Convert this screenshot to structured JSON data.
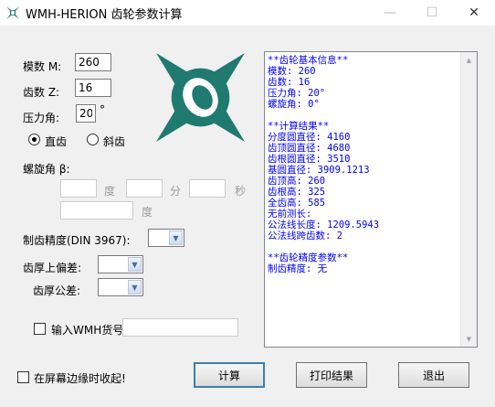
{
  "window": {
    "title": "WMH-HERION 齿轮参数计算"
  },
  "params": {
    "module_label": "模数 M:",
    "module_value": "260",
    "teeth_label": "齿数 Z:",
    "teeth_value": "16",
    "pressure_label": "压力角:",
    "pressure_value": "20",
    "pressure_unit": "°"
  },
  "gear_type": {
    "spur_label": "直齿",
    "helical_label": "斜齿",
    "selected": "spur"
  },
  "helix": {
    "label": "螺旋角 β:",
    "deg_unit": "度",
    "min_unit": "分",
    "sec_unit": "秒",
    "deg2_unit": "度"
  },
  "precision": {
    "label": "制齿精度(DIN 3967):"
  },
  "thickness": {
    "upper_label": "齿厚上偏差:",
    "tol_label": "齿厚公差:"
  },
  "wmh": {
    "label": "输入WMH货号"
  },
  "collapse": {
    "label": "在屏幕边缘时收起!"
  },
  "buttons": {
    "calc": "计算",
    "print": "打印结果",
    "exit": "退出"
  },
  "result_lines": [
    "**齿轮基本信息**",
    "模数: 260",
    "齿数: 16",
    "压力角: 20°",
    "螺旋角: 0°",
    "",
    "**计算结果**",
    "分度圆直径: 4160",
    "齿顶圆直径: 4680",
    "齿根圆直径: 3510",
    "基圆直径: 3909.1213",
    "齿顶高: 260",
    "齿根高: 325",
    "全齿高: 585",
    "无前测长:",
    "公法线长度: 1209.5943",
    "公法线跨齿数: 2",
    "",
    "**齿轮精度参数**",
    "制齿精度: 无"
  ],
  "colors": {
    "logo": "#1f7a70",
    "result_text": "#0000ff",
    "default_button_border": "#3c7fb1"
  },
  "icons": {
    "app": "wmh-logo-icon",
    "minimize": "minimize-icon",
    "maximize": "maximize-icon",
    "close": "close-icon"
  }
}
